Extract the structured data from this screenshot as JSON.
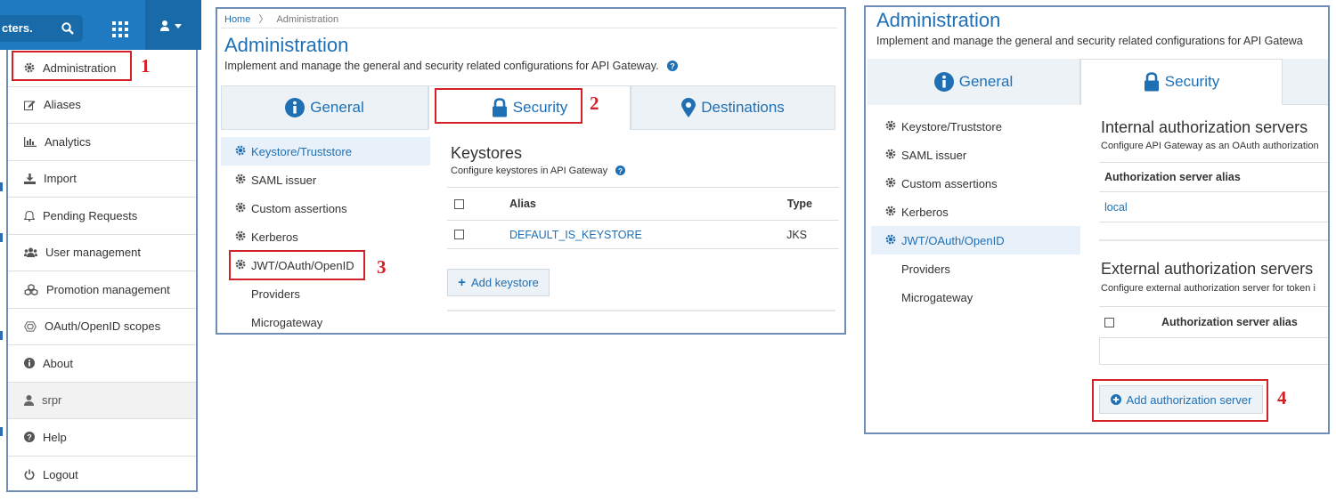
{
  "panel1": {
    "search_text": "cters.",
    "menu": [
      {
        "label": "Administration",
        "icon": "gear-icon"
      },
      {
        "label": "Aliases",
        "icon": "edit-icon"
      },
      {
        "label": "Analytics",
        "icon": "bar-chart-icon"
      },
      {
        "label": "Import",
        "icon": "download-icon"
      },
      {
        "label": "Pending Requests",
        "icon": "bell-icon"
      },
      {
        "label": "User management",
        "icon": "users-icon"
      },
      {
        "label": "Promotion management",
        "icon": "cubes-icon"
      },
      {
        "label": "OAuth/OpenID scopes",
        "icon": "hexagon-icon"
      },
      {
        "label": "About",
        "icon": "info-icon"
      },
      {
        "label": "srpr",
        "icon": "user-icon"
      },
      {
        "label": "Help",
        "icon": "question-icon"
      },
      {
        "label": "Logout",
        "icon": "power-icon"
      }
    ],
    "step": "1"
  },
  "panel2": {
    "breadcrumb_home": "Home",
    "breadcrumb_sep": "〉",
    "breadcrumb_current": "Administration",
    "title": "Administration",
    "subtitle": "Implement and manage the general and security related configurations for API Gateway.",
    "tabs": [
      "General",
      "Security",
      "Destinations"
    ],
    "step_tab": "2",
    "side": [
      "Keystore/Truststore",
      "SAML issuer",
      "Custom assertions",
      "Kerberos",
      "JWT/OAuth/OpenID",
      "Providers",
      "Microgateway"
    ],
    "step_side": "3",
    "section_title": "Keystores",
    "section_sub": "Configure keystores in API Gateway",
    "table_headers": [
      "Alias",
      "Type"
    ],
    "table_rows": [
      {
        "alias": "DEFAULT_IS_KEYSTORE",
        "type": "JKS"
      }
    ],
    "add_button": "Add keystore"
  },
  "panel3": {
    "title": "Administration",
    "subtitle": "Implement and manage the general and security related configurations for API Gatewa",
    "tabs": [
      "General",
      "Security"
    ],
    "side": [
      "Keystore/Truststore",
      "SAML issuer",
      "Custom assertions",
      "Kerberos",
      "JWT/OAuth/OpenID",
      "Providers",
      "Microgateway"
    ],
    "internal_title": "Internal authorization servers",
    "internal_sub": "Configure API Gateway as an OAuth authorization",
    "internal_header": "Authorization server alias",
    "internal_row": "local",
    "external_title": "External authorization servers",
    "external_sub": "Configure external authorization server for token i",
    "external_header": "Authorization server alias",
    "add_button": "Add authorization server",
    "step": "4"
  },
  "colors": {
    "accent": "#1f6fb5",
    "topbar": "#1f7ac2",
    "callout": "#d32128",
    "frame": "#6f8db7"
  }
}
